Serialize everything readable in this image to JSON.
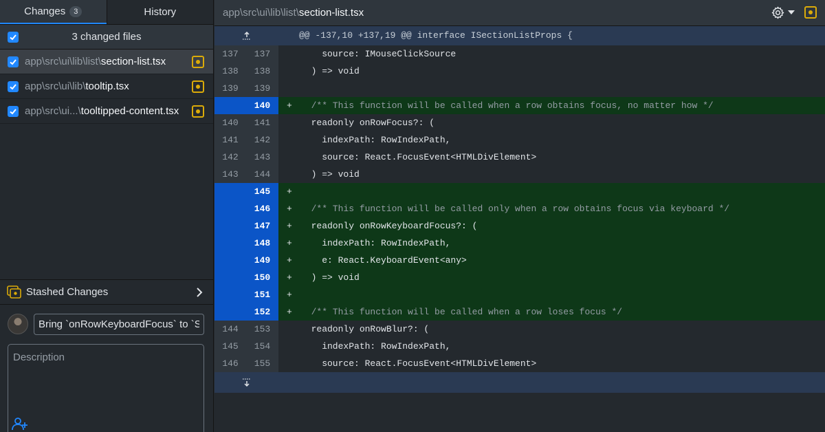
{
  "tabs": {
    "changes": {
      "label": "Changes",
      "count": "3"
    },
    "history": {
      "label": "History"
    }
  },
  "changes_header": {
    "label": "3 changed files"
  },
  "files": [
    {
      "dir": "app\\src\\ui\\lib\\list\\",
      "name": "section-list.tsx"
    },
    {
      "dir": "app\\src\\ui\\lib\\",
      "name": "tooltip.tsx"
    },
    {
      "dir": "app\\src\\ui...\\",
      "name": "tooltipped-content.tsx"
    }
  ],
  "stash": {
    "label": "Stashed Changes"
  },
  "commit": {
    "summary_value": "Bring `onRowKeyboardFocus` to `Se",
    "description_placeholder": "Description"
  },
  "diff": {
    "file_dir": "app\\src\\ui\\lib\\list\\",
    "file_name": "section-list.tsx",
    "hunk_header": "@@ -137,10 +137,19 @@ interface ISectionListProps {",
    "lines": [
      {
        "type": "ctx",
        "old": "137",
        "new": "137",
        "code": "    source: IMouseClickSource"
      },
      {
        "type": "ctx",
        "old": "138",
        "new": "138",
        "code": "  ) => void"
      },
      {
        "type": "ctx",
        "old": "139",
        "new": "139",
        "code": ""
      },
      {
        "type": "add",
        "old": "",
        "new": "140",
        "code": "  /** This function will be called when a row obtains focus, no matter how */"
      },
      {
        "type": "ctx",
        "old": "140",
        "new": "141",
        "code": "  readonly onRowFocus?: ("
      },
      {
        "type": "ctx",
        "old": "141",
        "new": "142",
        "code": "    indexPath: RowIndexPath,"
      },
      {
        "type": "ctx",
        "old": "142",
        "new": "143",
        "code": "    source: React.FocusEvent<HTMLDivElement>"
      },
      {
        "type": "ctx",
        "old": "143",
        "new": "144",
        "code": "  ) => void"
      },
      {
        "type": "add",
        "old": "",
        "new": "145",
        "code": ""
      },
      {
        "type": "add",
        "old": "",
        "new": "146",
        "code": "  /** This function will be called only when a row obtains focus via keyboard */"
      },
      {
        "type": "add",
        "old": "",
        "new": "147",
        "code": "  readonly onRowKeyboardFocus?: ("
      },
      {
        "type": "add",
        "old": "",
        "new": "148",
        "code": "    indexPath: RowIndexPath,"
      },
      {
        "type": "add",
        "old": "",
        "new": "149",
        "code": "    e: React.KeyboardEvent<any>"
      },
      {
        "type": "add",
        "old": "",
        "new": "150",
        "code": "  ) => void"
      },
      {
        "type": "add",
        "old": "",
        "new": "151",
        "code": ""
      },
      {
        "type": "add",
        "old": "",
        "new": "152",
        "code": "  /** This function will be called when a row loses focus */"
      },
      {
        "type": "ctx",
        "old": "144",
        "new": "153",
        "code": "  readonly onRowBlur?: ("
      },
      {
        "type": "ctx",
        "old": "145",
        "new": "154",
        "code": "    indexPath: RowIndexPath,"
      },
      {
        "type": "ctx",
        "old": "146",
        "new": "155",
        "code": "    source: React.FocusEvent<HTMLDivElement>"
      }
    ]
  },
  "colors": {
    "accent": "#2188ff",
    "added_bg": "#0e3818",
    "added_gutter": "#0b55c7",
    "modified": "#dbab09"
  },
  "icons": [
    "checkbox-icon",
    "modified-file-icon",
    "stash-icon",
    "chevron-right-icon",
    "gear-icon",
    "caret-down-icon",
    "add-coauthor-icon",
    "expand-up-icon",
    "expand-down-icon"
  ]
}
